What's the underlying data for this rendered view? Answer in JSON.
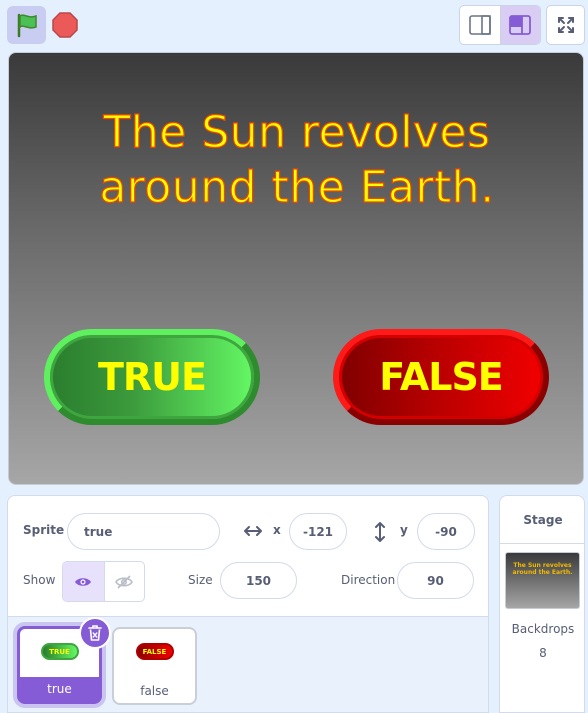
{
  "toolbar": {
    "green_flag_icon": "green-flag-icon",
    "stop_icon": "stop-icon",
    "small_stage_icon": "small-stage-icon",
    "normal_stage_icon": "normal-stage-icon",
    "fullscreen_icon": "fullscreen-icon"
  },
  "stage": {
    "question_line1": "The Sun revolves",
    "question_line2": "around the Earth.",
    "true_button": "TRUE",
    "false_button": "FALSE"
  },
  "sprite_info": {
    "sprite_label": "Sprite",
    "sprite_name": "true",
    "x_label": "x",
    "x_value": "-121",
    "y_label": "y",
    "y_value": "-90",
    "show_label": "Show",
    "size_label": "Size",
    "size_value": "150",
    "direction_label": "Direction",
    "direction_value": "90"
  },
  "sprites": [
    {
      "name": "true",
      "thumb_text": "TRUE",
      "selected": true
    },
    {
      "name": "false",
      "thumb_text": "FALSE",
      "selected": false
    }
  ],
  "stage_panel": {
    "title": "Stage",
    "thumb_text": "The Sun revolves around the Earth.",
    "backdrops_label": "Backdrops",
    "backdrops_count": "8"
  },
  "colors": {
    "accent": "#855cd6",
    "background": "#e5f0ff",
    "question_text": "#ffff00",
    "true_green": "#3c9a3c",
    "false_red": "#d40000"
  }
}
